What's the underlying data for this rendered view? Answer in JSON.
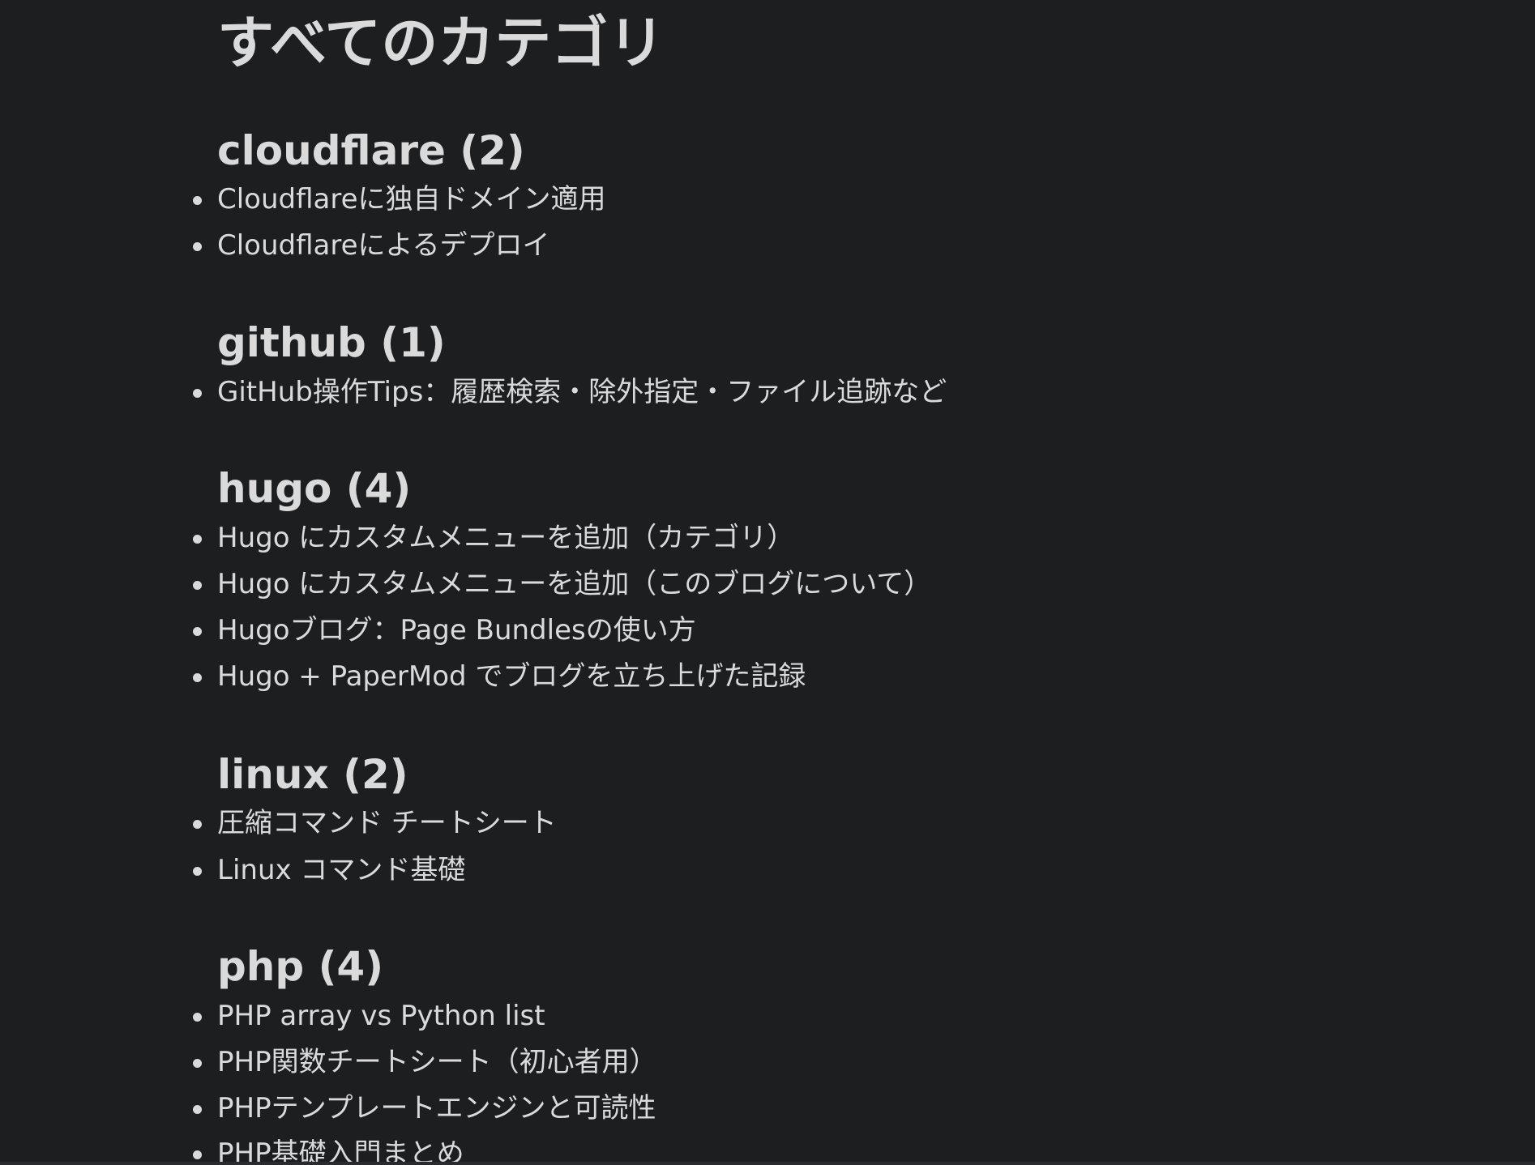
{
  "page": {
    "title": "すべてのカテゴリ"
  },
  "categories": [
    {
      "title": "cloudflare (2)",
      "posts": [
        "Cloudflareに独自ドメイン適用",
        "Cloudflareによるデプロイ"
      ]
    },
    {
      "title": "github (1)",
      "posts": [
        "GitHub操作Tips：履歴検索・除外指定・ファイル追跡など"
      ]
    },
    {
      "title": "hugo (4)",
      "posts": [
        "Hugo にカスタムメニューを追加（カテゴリ）",
        "Hugo にカスタムメニューを追加（このブログについて）",
        "Hugoブログ：Page Bundlesの使い方",
        "Hugo + PaperMod でブログを立ち上げた記録"
      ]
    },
    {
      "title": "linux (2)",
      "posts": [
        "圧縮コマンド チートシート",
        "Linux コマンド基礎"
      ]
    },
    {
      "title": "php (4)",
      "posts": [
        "PHP array vs Python list",
        "PHP関数チートシート（初心者用）",
        "PHPテンプレートエンジンと可読性",
        "PHP基礎入門まとめ"
      ]
    }
  ],
  "colors": {
    "background": "#1d1e20",
    "text": "#dadadb"
  }
}
